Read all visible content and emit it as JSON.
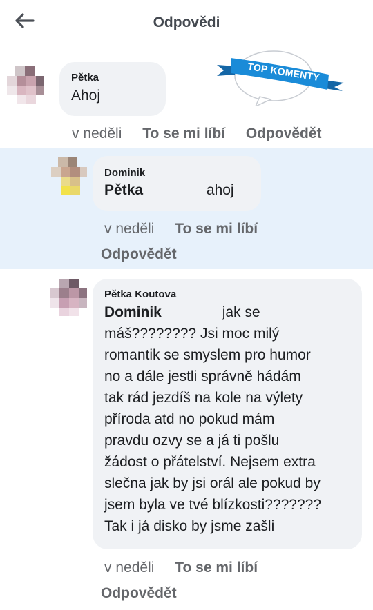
{
  "header": {
    "back_icon": "arrow-left-icon",
    "title": "Odpovědi"
  },
  "badge": {
    "text": "TOP KOMENTY",
    "icon": "speech-bubble-ribbon-icon",
    "color": "#1a8bd8"
  },
  "comments": [
    {
      "author": "Pětka",
      "text": "Ahoj",
      "time": "v neděli",
      "like_label": "To se mi líbí",
      "reply_label": "Odpovědět"
    },
    {
      "author": "Dominik",
      "mention": "Pětka",
      "text": "ahoj",
      "time": "v neděli",
      "like_label": "To se mi líbí",
      "reply_label": "Odpovědět"
    },
    {
      "author": "Pětka Koutova",
      "mention": "Dominik",
      "text_lines": [
        "jak se",
        "máš???????? Jsi moc milý",
        "romantik se smyslem pro humor",
        "no a dále jestli správně hádám",
        "tak rád jezdíš na kole na výlety",
        "příroda atd no pokud mám",
        "pravdu ozvy se a já ti pošlu",
        "žádost o přátelství. Nejsem extra",
        "slečna jak by jsi orál ale pokud by",
        "jsem byla ve tvé blízkosti???????",
        "Tak i já disko by jsme zašli"
      ],
      "time": "v neděli",
      "like_label": "To se mi líbí",
      "reply_label": "Odpovědět"
    }
  ],
  "colors": {
    "highlight": "#e7f1fb",
    "bubble": "#f0f2f5",
    "meta_text": "#65676b"
  }
}
